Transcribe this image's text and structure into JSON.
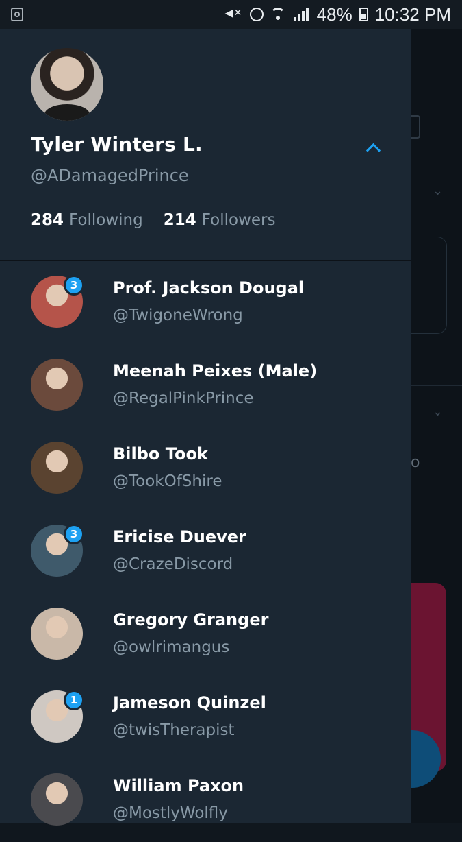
{
  "status_bar": {
    "battery": "48%",
    "time": "10:32 PM",
    "icons": [
      "recycle-icon",
      "mute-icon",
      "alarm-icon",
      "wifi-icon",
      "signal-icon",
      "battery-icon"
    ]
  },
  "profile": {
    "name": "Tyler Winters L.",
    "handle": "@ADamagedPrince",
    "following_count": "284",
    "following_label": "Following",
    "followers_count": "214",
    "followers_label": "Followers"
  },
  "accounts": [
    {
      "name": "Prof. Jackson Dougal",
      "handle": "@TwigoneWrong",
      "badge": "3",
      "avatar_color": "#b5544a"
    },
    {
      "name": "Meenah Peixes (Male)",
      "handle": "@RegalPinkPrince",
      "badge": "",
      "avatar_color": "#6b4a3c"
    },
    {
      "name": "Bilbo Took",
      "handle": "@TookOfShire",
      "badge": "",
      "avatar_color": "#5a4330"
    },
    {
      "name": "Ericise Duever",
      "handle": "@CrazeDiscord",
      "badge": "3",
      "avatar_color": "#3f5a6b"
    },
    {
      "name": "Gregory Granger",
      "handle": "@owlrimangus",
      "badge": "",
      "avatar_color": "#c9b8a8"
    },
    {
      "name": "Jameson Quinzel",
      "handle": "@twisTherapist",
      "badge": "1",
      "avatar_color": "#cfc8c2"
    },
    {
      "name": "William Paxon",
      "handle": "@MostlyWolfly",
      "badge": "",
      "avatar_color": "#4a4a4e"
    }
  ],
  "background": {
    "partial_text": "o"
  },
  "colors": {
    "accent": "#1da1f2",
    "drawer_bg": "#1b2733",
    "secondary_text": "#8899a6"
  }
}
